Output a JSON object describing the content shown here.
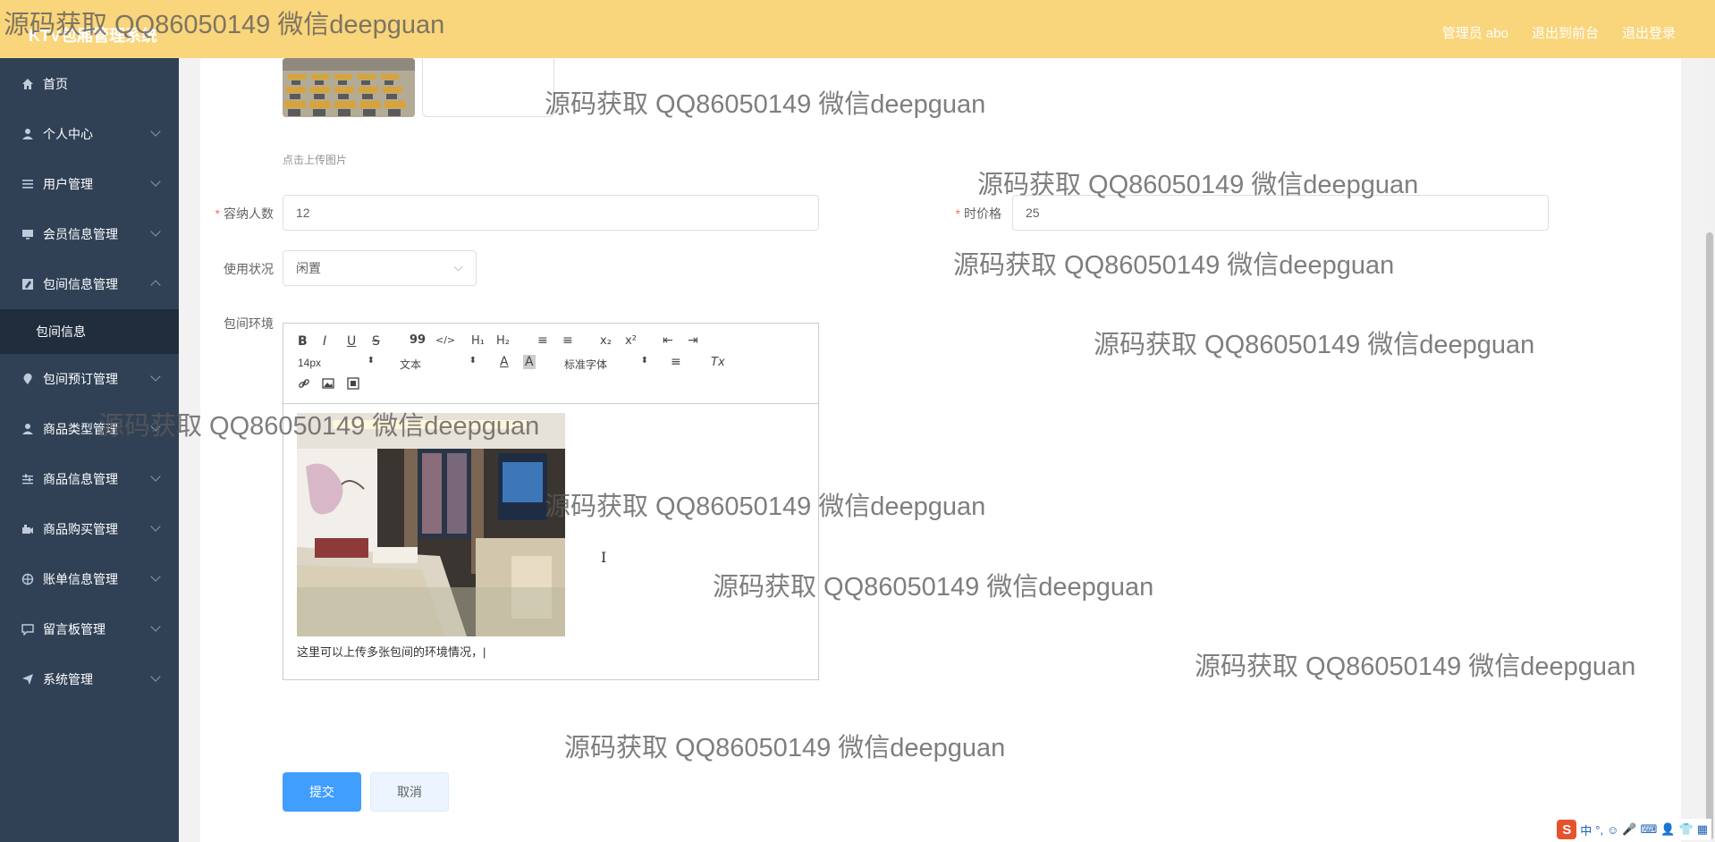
{
  "app": {
    "brand": "KTV包厢管理系统",
    "nav": [
      "管理员 abo",
      "退出到前台",
      "退出登录"
    ]
  },
  "sidebar": {
    "items": [
      {
        "label": "首页",
        "icon": "home-icon",
        "expandable": false
      },
      {
        "label": "个人中心",
        "icon": "user-icon",
        "expandable": true
      },
      {
        "label": "用户管理",
        "icon": "list-icon",
        "expandable": true
      },
      {
        "label": "会员信息管理",
        "icon": "monitor-icon",
        "expandable": true
      },
      {
        "label": "包间信息管理",
        "icon": "edit-icon",
        "expandable": true,
        "expanded": true
      },
      {
        "label": "包间预订管理",
        "icon": "location-icon",
        "expandable": true
      },
      {
        "label": "商品类型管理",
        "icon": "user-icon",
        "expandable": true
      },
      {
        "label": "商品信息管理",
        "icon": "sliders-icon",
        "expandable": true
      },
      {
        "label": "商品购买管理",
        "icon": "camera-icon",
        "expandable": true
      },
      {
        "label": "账单信息管理",
        "icon": "globe-icon",
        "expandable": true
      },
      {
        "label": "留言板管理",
        "icon": "chat-icon",
        "expandable": true
      },
      {
        "label": "系统管理",
        "icon": "send-icon",
        "expandable": true
      }
    ],
    "sub_item": "包间信息"
  },
  "form": {
    "upload_hint": "点击上传图片",
    "capacity": {
      "label": "容纳人数",
      "value": "12"
    },
    "hourly_price": {
      "label": "时价格",
      "value": "25"
    },
    "usage_status": {
      "label": "使用状况",
      "value": "闲置"
    },
    "environment": {
      "label": "包间环境"
    },
    "editor": {
      "toolbar": {
        "bold": "B",
        "italic": "I",
        "underline": "U",
        "strike": "S",
        "quote": "99",
        "code": "</>",
        "h1": "H₁",
        "h2": "H₂",
        "ol": "≡",
        "ul": "≡",
        "sub": "x₂",
        "sup": "x²",
        "outdent": "⇤",
        "indent": "⇥",
        "size": "14px",
        "header": "文本",
        "color": "A",
        "background": "A",
        "font": "标准字体",
        "align": "≡",
        "clean": "Tx",
        "link": "🔗",
        "image": "▣",
        "video": "▦"
      },
      "content": "这里可以上传多张包间的环境情况，|"
    },
    "submit": "提交",
    "cancel": "取消"
  },
  "watermark": "源码获取 QQ86050149 微信deepguan",
  "tray": {
    "ime": "中",
    "symbols": "°,"
  }
}
